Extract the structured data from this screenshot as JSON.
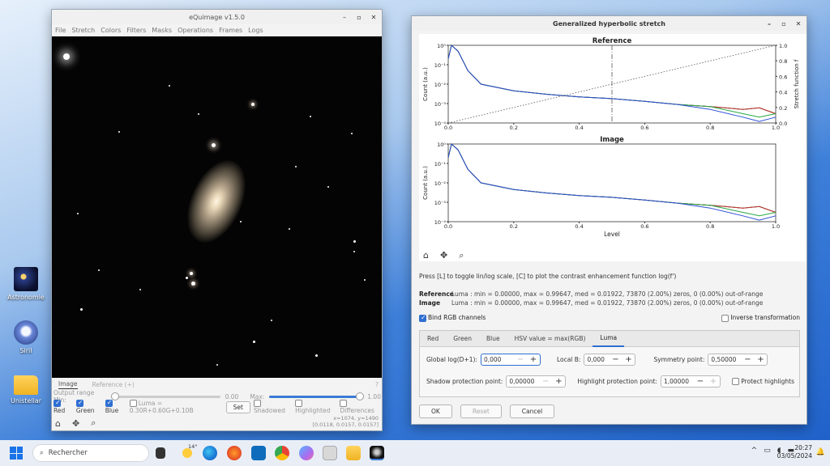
{
  "desktop": {
    "icons": [
      {
        "label": "Astronomie"
      },
      {
        "label": "Siril"
      },
      {
        "label": "Unistellar"
      }
    ]
  },
  "equimage": {
    "title": "eQuimage v1.5.0",
    "menu": [
      "File",
      "Stretch",
      "Colors",
      "Filters",
      "Masks",
      "Operations",
      "Frames",
      "Logs"
    ],
    "tabs": {
      "image": "Image",
      "reference": "Reference (+)",
      "help": "?"
    },
    "output_range": {
      "label": "Output range Min:",
      "min_value": "0.00",
      "max_label": "Max:",
      "max_value": "1.00",
      "min_fraction": 0.0,
      "max_fraction": 1.0
    },
    "channels": {
      "red": "Red",
      "green": "Green",
      "blue": "Blue",
      "luma": "Luma = 0.30R+0.60G+0.10B",
      "set": "Set",
      "shadowed": "Shadowed",
      "highlighted": "Highlighted",
      "differences": "Differences"
    },
    "coords": {
      "line1": "x=1074, y=1490",
      "line2": "[0.0118, 0.0157, 0.0157]"
    }
  },
  "ghs": {
    "title": "Generalized hyperbolic stretch",
    "plot": {
      "top_title": "Reference",
      "bottom_title": "Image",
      "ylabel": "Count (a.u.)",
      "y2label": "Stretch function f",
      "xlabel": "Level",
      "xticks": [
        "0.0",
        "0.2",
        "0.4",
        "0.6",
        "0.8",
        "1.0"
      ],
      "yticks": [
        "10⁰",
        "10⁻¹",
        "10⁻²",
        "10⁻³",
        "10⁻⁴"
      ],
      "y2ticks": [
        "1.0",
        "0.8",
        "0.6",
        "0.4",
        "0.2",
        "0.0"
      ]
    },
    "chart_data": {
      "type": "line",
      "x": [
        0.0,
        0.01,
        0.03,
        0.06,
        0.1,
        0.2,
        0.3,
        0.4,
        0.5,
        0.6,
        0.7,
        0.8,
        0.9,
        0.95,
        1.0
      ],
      "series": [
        {
          "name": "Luma",
          "color": "#222222",
          "values": [
            0.2,
            1.0,
            0.5,
            0.05,
            0.01,
            0.0045,
            0.003,
            0.0022,
            0.0018,
            0.0013,
            0.0009,
            0.0007,
            0.0005,
            0.0006,
            0.0003
          ]
        },
        {
          "name": "Red",
          "color": "#c0392b",
          "values": [
            0.2,
            1.0,
            0.5,
            0.05,
            0.01,
            0.0045,
            0.003,
            0.0022,
            0.0018,
            0.0013,
            0.0009,
            0.0007,
            0.0005,
            0.0006,
            0.0003
          ]
        },
        {
          "name": "Green",
          "color": "#27a844",
          "values": [
            0.2,
            1.0,
            0.5,
            0.05,
            0.01,
            0.0045,
            0.003,
            0.0022,
            0.0018,
            0.0013,
            0.0009,
            0.0007,
            0.0003,
            0.0002,
            0.0003
          ]
        },
        {
          "name": "Blue",
          "color": "#2b4fd6",
          "values": [
            0.2,
            1.0,
            0.5,
            0.05,
            0.01,
            0.0045,
            0.003,
            0.0022,
            0.0018,
            0.0013,
            0.0009,
            0.0005,
            0.0002,
            0.00012,
            0.0002
          ]
        }
      ],
      "stretch_function": {
        "x": [
          0,
          1
        ],
        "y": [
          0,
          1
        ]
      },
      "reference_line_x": 0.5,
      "xlim": [
        0,
        1
      ],
      "ylim": [
        0.0001,
        1
      ],
      "yscale": "log"
    },
    "hint": "Press [L] to toggle lin/log scale, [C] to plot the contrast enhancement function log(f')",
    "stats": {
      "ref_label": "Reference",
      "ref_text": "Luma : min = 0.00000, max = 0.99647, med = 0.01922, 73870 (2.00%) zeros, 0 (0.00%) out-of-range",
      "img_label": "Image",
      "img_text": "Luma : min = 0.00000, max = 0.99647, med = 0.01922, 73870 (2.00%) zeros, 0 (0.00%) out-of-range"
    },
    "bind_rgb": "Bind RGB channels",
    "inverse": "Inverse transformation",
    "channel_tabs": [
      "Red",
      "Green",
      "Blue",
      "HSV value = max(RGB)",
      "Luma"
    ],
    "params": {
      "global_label": "Global log(D+1):",
      "global_value": "0,000",
      "localb_label": "Local B:",
      "localb_value": "0,000",
      "sym_label": "Symmetry point:",
      "sym_value": "0,50000",
      "shadow_label": "Shadow protection point:",
      "shadow_value": "0,00000",
      "highlight_label": "Highlight protection point:",
      "highlight_value": "1,00000",
      "protect_label": "Protect highlights"
    },
    "buttons": {
      "ok": "OK",
      "reset": "Reset",
      "cancel": "Cancel"
    }
  },
  "taskbar": {
    "search_placeholder": "Rechercher",
    "weather": "14°",
    "time": "20:27",
    "date": "03/05/2024"
  }
}
